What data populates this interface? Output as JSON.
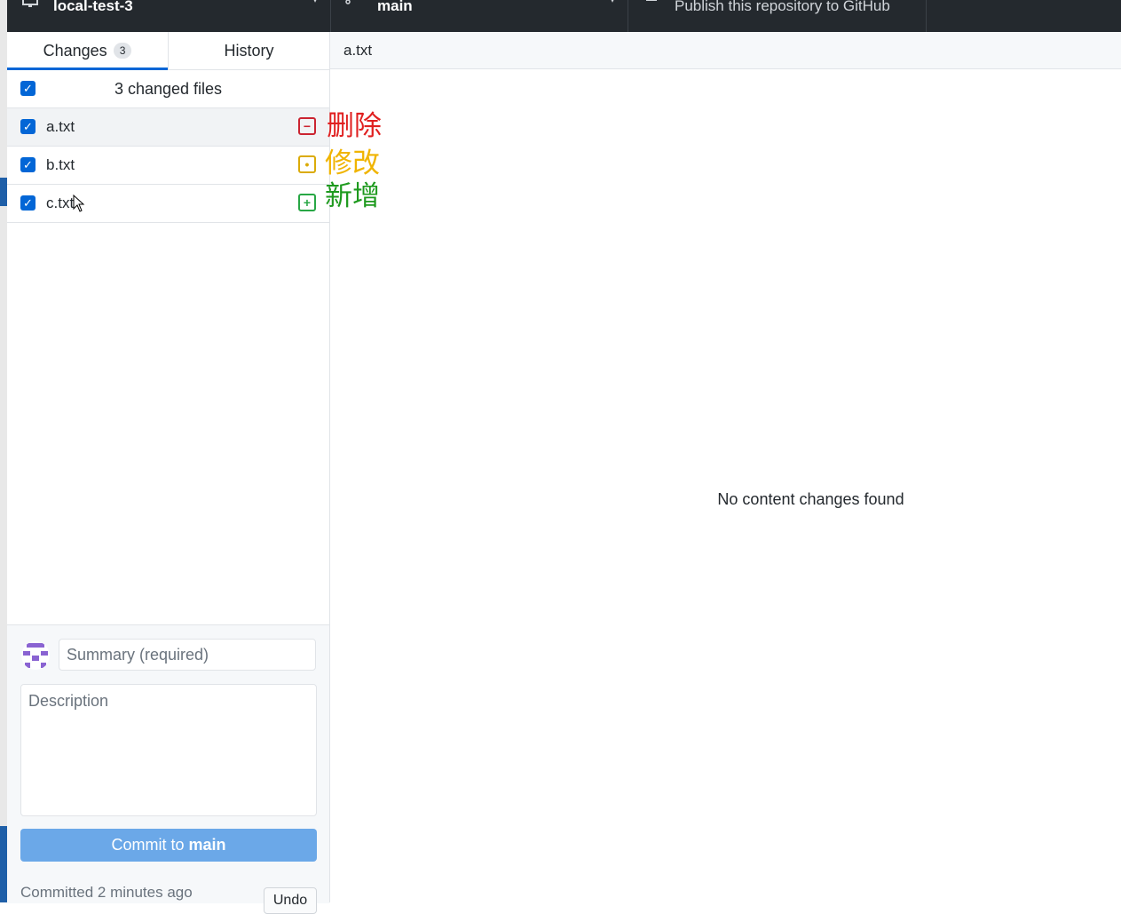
{
  "toolbar": {
    "repo_label": "local-test-3",
    "branch_label": "main",
    "publish_label": "Publish this repository to GitHub"
  },
  "tabs": {
    "changes_label": "Changes",
    "changes_count": "3",
    "history_label": "History"
  },
  "changes": {
    "header": "3 changed files",
    "files": [
      {
        "name": "a.txt",
        "status": "deleted",
        "symbol": "−"
      },
      {
        "name": "b.txt",
        "status": "modified",
        "symbol": "•"
      },
      {
        "name": "c.txt",
        "status": "added",
        "symbol": "+"
      }
    ]
  },
  "annotations": {
    "deleted": "删除",
    "modified": "修改",
    "added": "新增"
  },
  "commit": {
    "summary_placeholder": "Summary (required)",
    "description_placeholder": "Description",
    "button_prefix": "Commit to ",
    "button_branch": "main",
    "last_commit": "Committed 2 minutes ago",
    "undo_label": "Undo"
  },
  "diff": {
    "file_name": "a.txt",
    "message": "No content changes found"
  },
  "colors": {
    "accent": "#0366d6",
    "deleted": "#cb2431",
    "modified": "#dbab09",
    "added": "#28a745",
    "toolbar_bg": "#24292e"
  }
}
